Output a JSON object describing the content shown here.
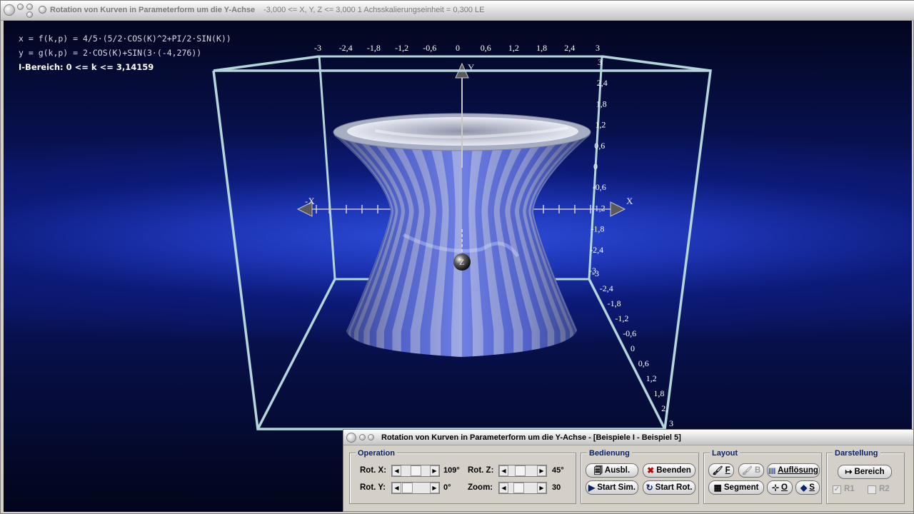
{
  "window": {
    "title": "Rotation von Kurven in Parameterform um die Y-Achse",
    "subtitle": "-3,000 <= X, Y, Z <= 3,000     1 Achsskalierungseinheit = 0,300 LE"
  },
  "overlay": {
    "line1": "x = f(k,p) = 4/5·(5/2·COS(K)^2+PI/2·SIN(K))",
    "line2": "y = g(k,p) = 2·COS(K)+SIN(3·(-4,276))",
    "line3": "I-Bereich: 0 <= k <= 3,14159"
  },
  "axes": {
    "top_ticks": [
      "-3",
      "-2,4",
      "-1,8",
      "-1,2",
      "-0,6",
      "0",
      "0,6",
      "1,2",
      "1,8",
      "2,4",
      "3"
    ],
    "right_ticks": [
      "3",
      "2,4",
      "1,8",
      "1,2",
      "0,6",
      "0",
      "-0,6",
      "-1,2",
      "-1,8",
      "-2,4",
      "-3"
    ],
    "diag_ticks": [
      "-3",
      "-2,4",
      "-1,8",
      "-1,2",
      "-0,6",
      "0",
      "0,6",
      "1,2",
      "1,8",
      "2,",
      "3"
    ],
    "x_pos_label": "X",
    "x_neg_label": "-X",
    "y_label": "Y",
    "z_label": "Z"
  },
  "panel": {
    "title": "Rotation von Kurven in Parameterform um die Y-Achse - [Beispiele I - Beispiel 5]",
    "operation": {
      "group_label": "Operation",
      "rot_x_label": "Rot. X:",
      "rot_x_value": "109°",
      "rot_y_label": "Rot. Y:",
      "rot_y_value": "0°",
      "rot_z_label": "Rot. Z:",
      "rot_z_value": "45°",
      "zoom_label": "Zoom:",
      "zoom_value": "30"
    },
    "bedienung": {
      "group_label": "Bedienung",
      "ausbl": "Ausbl.",
      "beenden": "Beenden",
      "start_sim": "Start Sim.",
      "start_rot": "Start Rot."
    },
    "layout": {
      "group_label": "Layout",
      "f": "F",
      "b": "B",
      "aufloesung": "Auflösung",
      "segment": "Segment",
      "o": "O",
      "s": "S"
    },
    "darstellung": {
      "group_label": "Darstellung",
      "bereich": "Bereich",
      "r1": "R1",
      "r2": "R2"
    }
  },
  "colors": {
    "accent_label": "#0a246a",
    "box_line": "#b4d6da",
    "surface_stripe_light": "#c2c9e4",
    "surface_stripe_blue": "#5a6ee0"
  }
}
